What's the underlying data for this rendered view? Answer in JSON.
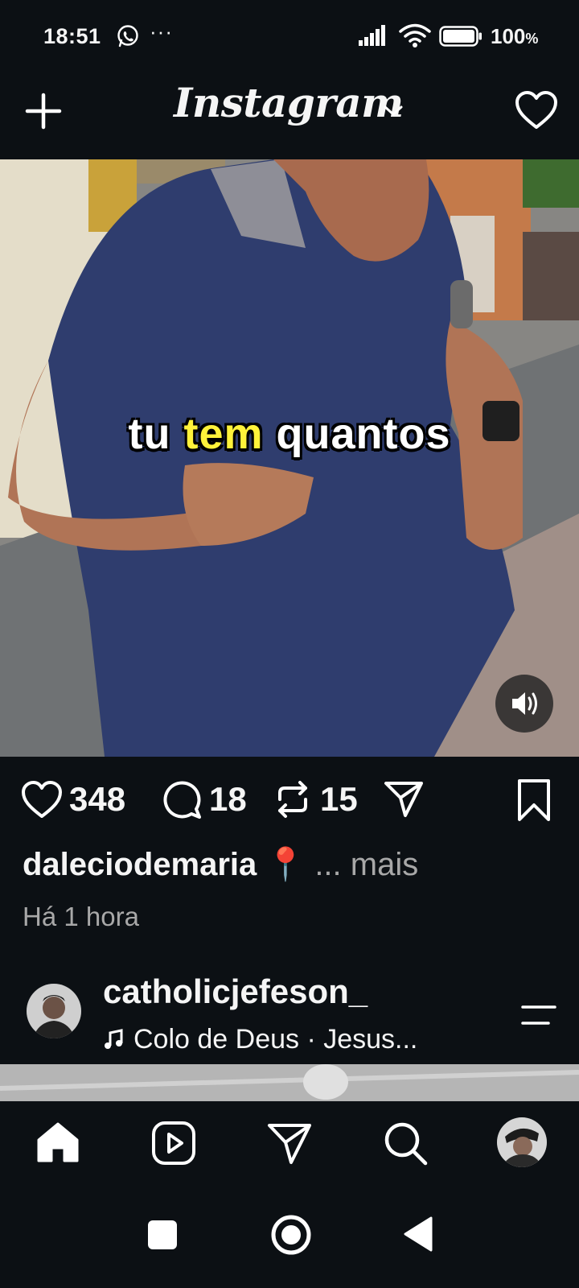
{
  "status_bar": {
    "time": "18:51",
    "battery": "100",
    "battery_unit": "%"
  },
  "header": {
    "logo": "Instagram"
  },
  "post": {
    "subtitle_words": [
      "tu",
      "tem",
      "quantos"
    ],
    "likes": "348",
    "comments": "18",
    "reposts": "15",
    "username": "daleciodemaria",
    "caption_emoji": "📍",
    "more": "... mais",
    "time_ago": "Há 1 hora"
  },
  "next_post": {
    "username": "catholicjefeson_",
    "audio": "Colo de Deus · Jesus..."
  },
  "colors": {
    "background": "#0c1014",
    "secondary_text": "#a8a8a8",
    "subtitle_highlight": "#fff23a"
  },
  "icons": [
    "whatsapp-icon",
    "more-dots-icon",
    "signal-icon",
    "wifi-icon",
    "battery-icon",
    "plus-icon",
    "chevron-down-icon",
    "heart-icon",
    "volume-icon",
    "like-icon",
    "comment-icon",
    "repost-icon",
    "share-icon",
    "bookmark-icon",
    "music-note-icon",
    "menu-icon",
    "home-icon",
    "reels-icon",
    "direct-icon",
    "search-icon",
    "square-icon",
    "circle-icon",
    "back-icon"
  ]
}
